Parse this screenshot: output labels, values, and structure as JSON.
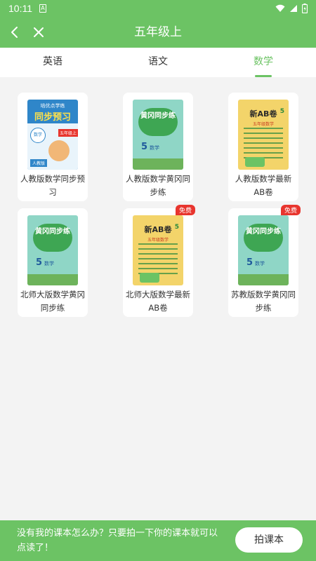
{
  "status": {
    "time": "10:11"
  },
  "header": {
    "title": "五年级上"
  },
  "tabs": [
    {
      "label": "英语"
    },
    {
      "label": "语文"
    },
    {
      "label": "数学"
    }
  ],
  "books": [
    {
      "label": "人教版数学同步预习",
      "free": false,
      "cover": "preview"
    },
    {
      "label": "人教版数学黄冈同步练",
      "free": false,
      "cover": "huanggang"
    },
    {
      "label": "人教版数学最新AB卷",
      "free": false,
      "cover": "ab"
    },
    {
      "label": "北师大版数学黄冈同步练",
      "free": false,
      "cover": "huanggang"
    },
    {
      "label": "北师大版数学最新AB卷",
      "free": true,
      "cover": "ab"
    },
    {
      "label": "苏教版数学黄冈同步练",
      "free": true,
      "cover": "huanggang"
    }
  ],
  "badge": {
    "free_label": "免费"
  },
  "covers": {
    "preview_title": "同步预习",
    "preview_top": "培优点学练",
    "preview_subject": "数学",
    "preview_grade": "五年级上",
    "preview_edition": "人教版",
    "huanggang_title": "黄冈同步练",
    "huanggang_num": "5",
    "huanggang_subject": "数学",
    "ab_title": "新AB卷",
    "ab_sub": "五年级数学",
    "ab_num": "5"
  },
  "footer": {
    "tip": "没有我的课本怎么办？只要拍一下你的课本就可以点读了！",
    "button": "拍课本"
  },
  "colors": {
    "primary": "#6cc364",
    "badge": "#e8352e"
  }
}
